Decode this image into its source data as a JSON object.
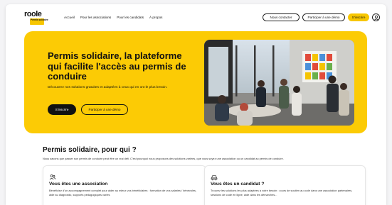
{
  "header": {
    "logo_text": "roole",
    "logo_sub": "Permis solidaire",
    "nav": [
      {
        "label": "Accueil"
      },
      {
        "label": "Pour les associations"
      },
      {
        "label": "Pour les candidats"
      },
      {
        "label": "À propos"
      }
    ],
    "contact_label": "Nous contacter",
    "demo_label": "Participer à une démo",
    "signup_label": "S'inscrire",
    "user_icon": "user-icon"
  },
  "hero": {
    "title": "Permis solidaire, la plateforme qui facilite l'accès au permis de conduire",
    "description": "Découvrez nos solutions gratuites et adaptées à ceux qui en ont le plus besoin.",
    "primary_button": "S'inscrire",
    "secondary_button": "Participer à une démo"
  },
  "section": {
    "title": "Permis solidaire, pour qui ?",
    "subtitle": "Nous savons que passer son permis de conduire peut être un vrai défi. C'est pourquoi nous proposons des solutions variées, que vous soyez une association ou un candidat au permis de conduire."
  },
  "cards": [
    {
      "icon": "people-icon",
      "title": "Vous êtes une association",
      "text": "Bénéficiez d'un accompagnement complet pour aider au mieux vos bénéficiaires : formation de vos salariés / bénévoles, aide au diagnostic, supports pédagogiques variés"
    },
    {
      "icon": "car-icon",
      "title": "Vous êtes un candidat ?",
      "text": "Trouvez les solutions les plus adaptées à votre besoin : cours de soutien au code dans une association partenaires, sessions de code en ligne, aide dans les démarches..."
    }
  ],
  "colors": {
    "accent": "#fccb05",
    "dark": "#111111",
    "background": "#f4f4f6"
  }
}
